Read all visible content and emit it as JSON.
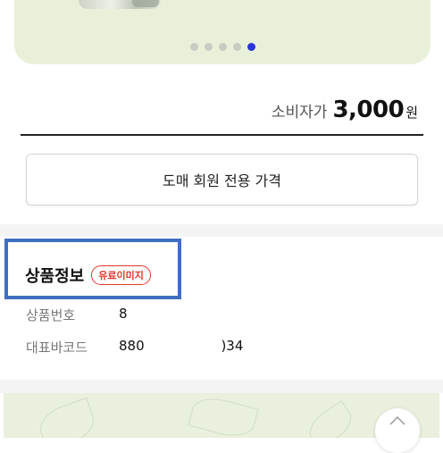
{
  "carousel": {
    "slide_count": 5,
    "active_index": 4,
    "dot_color": "#c8ccc3",
    "active_dot_color": "#2a35d8"
  },
  "price": {
    "label": "소비자가",
    "value": "3,000",
    "unit": "원"
  },
  "wholesale_button": {
    "label": "도매 회원 전용 가격"
  },
  "product_info": {
    "title": "상품정보",
    "badge": "유료이미지",
    "rows": [
      {
        "label": "상품번호",
        "value": "8"
      },
      {
        "label": "대표바코드",
        "value": "880                  )34"
      }
    ]
  },
  "highlight_color": "#3f6fbf",
  "badge_color": "#e0382b",
  "scroll_top_icon": "chevron-up-icon"
}
